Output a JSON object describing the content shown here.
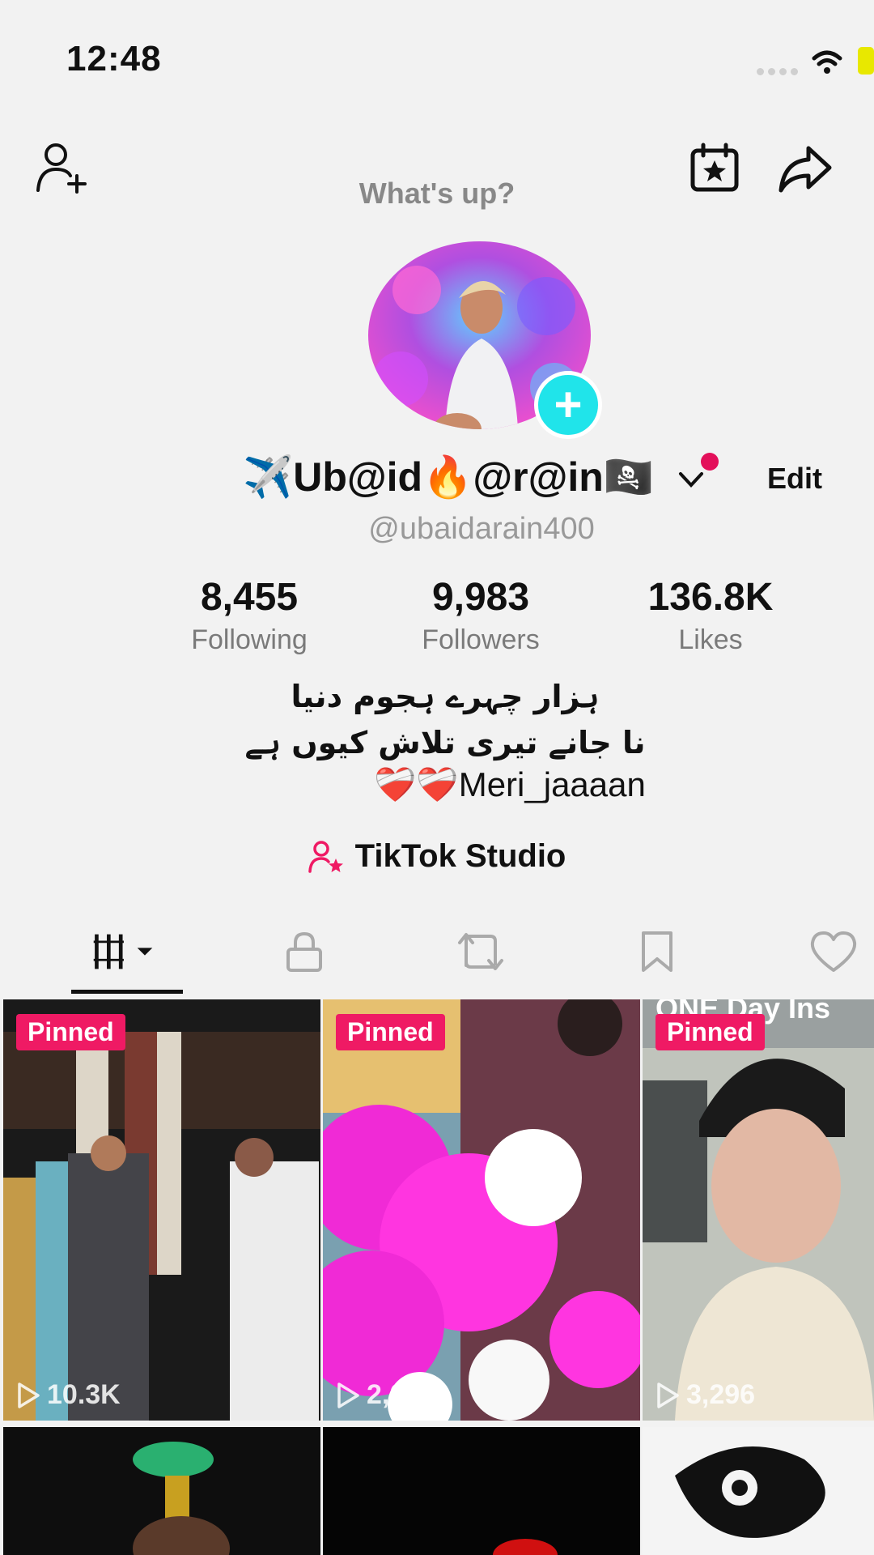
{
  "status_bar": {
    "time": "12:48"
  },
  "header": {
    "status_prompt": "What's up?"
  },
  "profile": {
    "display_name": "✈️Ub@id🔥@r@in🏴‍☠️",
    "edit_label": "Edit",
    "handle": "@ubaidarain400"
  },
  "stats": {
    "following": {
      "value": "8,455",
      "label": "Following"
    },
    "followers": {
      "value": "9,983",
      "label": "Followers"
    },
    "likes": {
      "value": "136.8K",
      "label": "Likes"
    }
  },
  "bio": {
    "line1": "ہزار چہرے ہجوم دنیا",
    "line2": "نا جانے تیری تلاش کیوں ہے",
    "line3": "❤️‍🩹❤️‍🩹Meri_jaaaan"
  },
  "studio": {
    "label": "TikTok Studio"
  },
  "tabs": [
    "videos-grid",
    "private",
    "reposts",
    "saved",
    "liked"
  ],
  "videos": [
    {
      "badge": "Pinned",
      "views": "10.3K"
    },
    {
      "badge": "Pinned",
      "views": "2,087"
    },
    {
      "badge": "Pinned",
      "views": "3,296",
      "caption": "ONE Day Ins"
    }
  ],
  "colors": {
    "accent": "#ef1a64",
    "plus": "#20e4ea"
  }
}
